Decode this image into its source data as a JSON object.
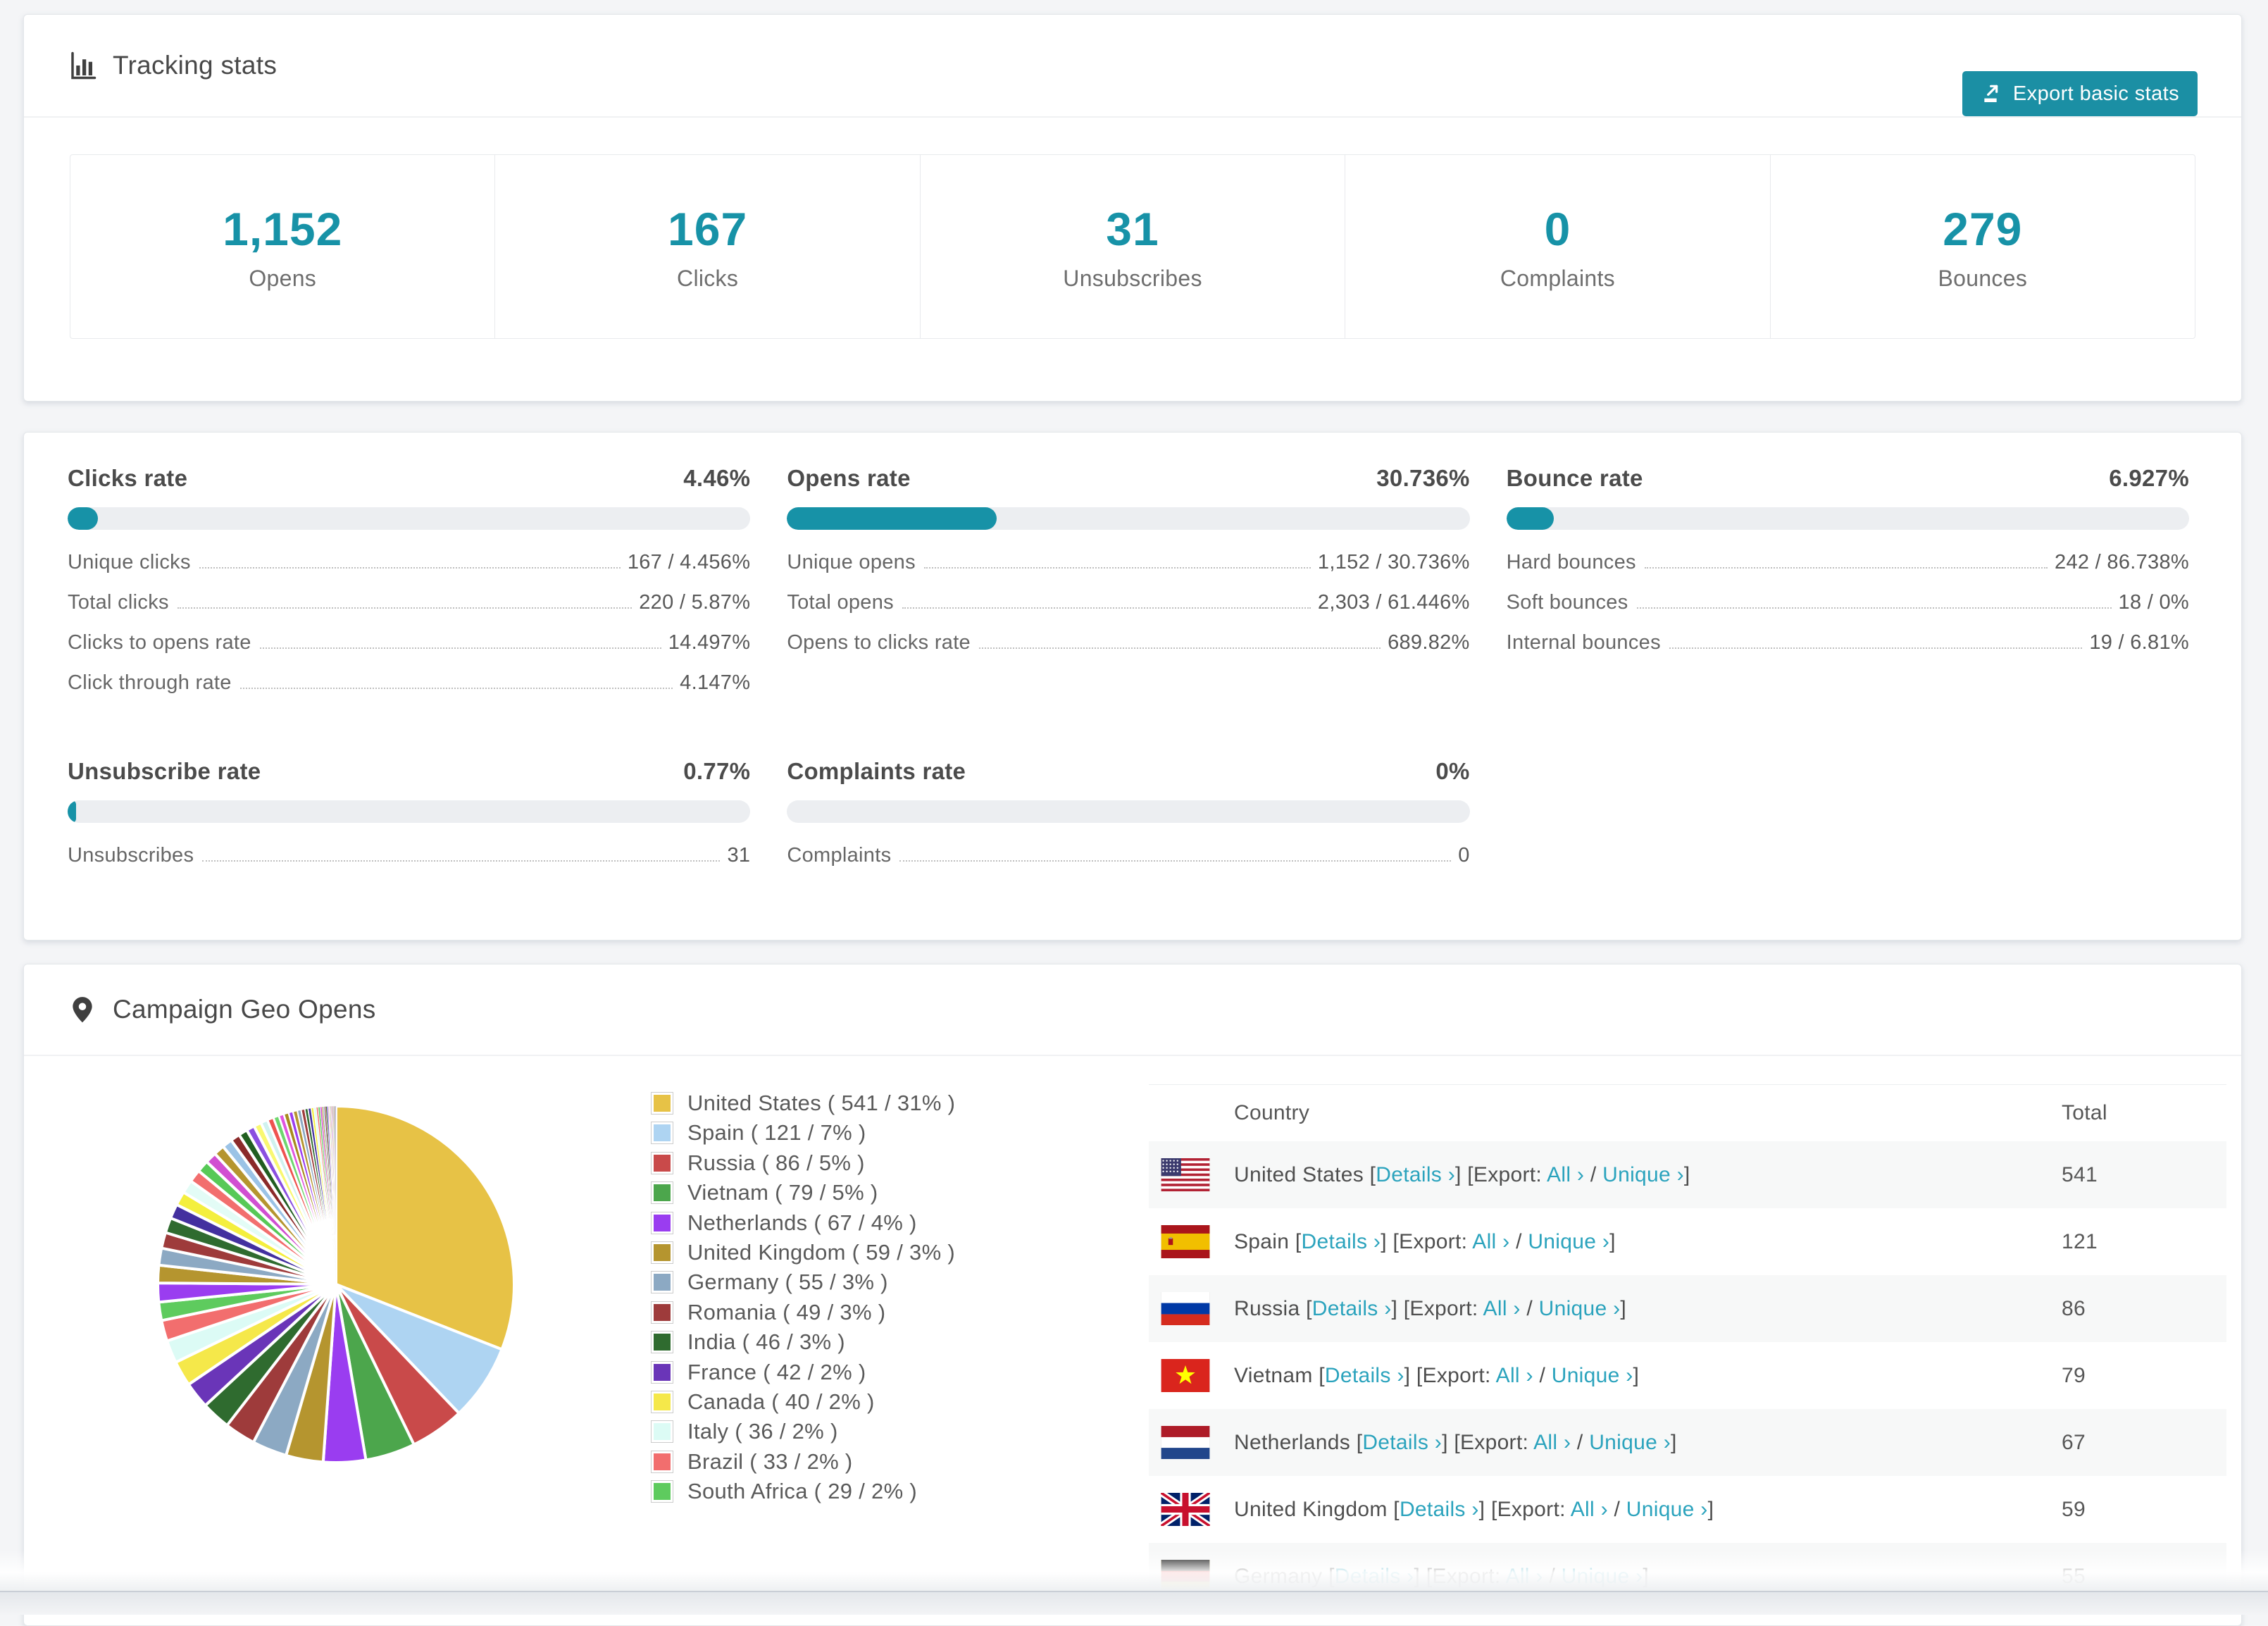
{
  "accent": "#1792a7",
  "link_color": "#2ba3bd",
  "tracking": {
    "title": "Tracking stats",
    "export_button": "Export basic stats",
    "stats": [
      {
        "value": "1,152",
        "label": "Opens"
      },
      {
        "value": "167",
        "label": "Clicks"
      },
      {
        "value": "31",
        "label": "Unsubscribes"
      },
      {
        "value": "0",
        "label": "Complaints"
      },
      {
        "value": "279",
        "label": "Bounces"
      }
    ]
  },
  "rates": {
    "sections": [
      {
        "title": "Clicks rate",
        "value": "4.46%",
        "pct": 4.46,
        "rows": [
          [
            "Unique clicks",
            "167 / 4.456%"
          ],
          [
            "Total clicks",
            "220 / 5.87%"
          ],
          [
            "Clicks to opens rate",
            "14.497%"
          ],
          [
            "Click through rate",
            "4.147%"
          ]
        ]
      },
      {
        "title": "Opens rate",
        "value": "30.736%",
        "pct": 30.736,
        "rows": [
          [
            "Unique opens",
            "1,152 / 30.736%"
          ],
          [
            "Total opens",
            "2,303 / 61.446%"
          ],
          [
            "Opens to clicks rate",
            "689.82%"
          ]
        ]
      },
      {
        "title": "Bounce rate",
        "value": "6.927%",
        "pct": 6.927,
        "rows": [
          [
            "Hard bounces",
            "242 / 86.738%"
          ],
          [
            "Soft bounces",
            "18 / 0%"
          ],
          [
            "Internal bounces",
            "19 / 6.81%"
          ]
        ]
      },
      {
        "title": "Unsubscribe rate",
        "value": "0.77%",
        "pct": 0.77,
        "rows": [
          [
            "Unsubscribes",
            "31"
          ]
        ]
      },
      {
        "title": "Complaints rate",
        "value": "0%",
        "pct": 0,
        "rows": [
          [
            "Complaints",
            "0"
          ]
        ]
      }
    ]
  },
  "geo": {
    "title": "Campaign Geo Opens",
    "legend": [
      {
        "name": "United States",
        "value": 541,
        "pct": 31,
        "color": "#e7c246"
      },
      {
        "name": "Spain",
        "value": 121,
        "pct": 7,
        "color": "#aed4f2"
      },
      {
        "name": "Russia",
        "value": 86,
        "pct": 5,
        "color": "#c94a4a"
      },
      {
        "name": "Vietnam",
        "value": 79,
        "pct": 5,
        "color": "#4ca64c"
      },
      {
        "name": "Netherlands",
        "value": 67,
        "pct": 4,
        "color": "#9a3df0"
      },
      {
        "name": "United Kingdom",
        "value": 59,
        "pct": 3,
        "color": "#b5952f"
      },
      {
        "name": "Germany",
        "value": 55,
        "pct": 3,
        "color": "#8ca9c3"
      },
      {
        "name": "Romania",
        "value": 49,
        "pct": 3,
        "color": "#9e3b3b"
      },
      {
        "name": "India",
        "value": 46,
        "pct": 3,
        "color": "#2f6b2f"
      },
      {
        "name": "France",
        "value": 42,
        "pct": 2,
        "color": "#6a35b8"
      },
      {
        "name": "Canada",
        "value": 40,
        "pct": 2,
        "color": "#f5e84a"
      },
      {
        "name": "Italy",
        "value": 36,
        "pct": 2,
        "color": "#dcfbf5"
      },
      {
        "name": "Brazil",
        "value": 33,
        "pct": 2,
        "color": "#f26e6e"
      },
      {
        "name": "South Africa",
        "value": 29,
        "pct": 2,
        "color": "#5ecb5e"
      }
    ],
    "table": {
      "headers": [
        "Country",
        "Total"
      ],
      "tok": {
        "t1": " [",
        "t2": "] [Export: ",
        "t3": " / ",
        "t4": "]",
        "details": "Details ›",
        "all": "All ›",
        "unique": "Unique ›"
      },
      "rows": [
        {
          "country": "United States",
          "flag": "us",
          "total": "541"
        },
        {
          "country": "Spain",
          "flag": "es",
          "total": "121"
        },
        {
          "country": "Russia",
          "flag": "ru",
          "total": "86"
        },
        {
          "country": "Vietnam",
          "flag": "vn",
          "total": "79"
        },
        {
          "country": "Netherlands",
          "flag": "nl",
          "total": "67"
        },
        {
          "country": "United Kingdom",
          "flag": "gb",
          "total": "59"
        },
        {
          "country": "Germany",
          "flag": "de",
          "total": "55"
        }
      ]
    }
  },
  "chart_data": {
    "type": "pie",
    "title": "Campaign Geo Opens",
    "unit": "opens",
    "legend_position": "right",
    "labeled_slices": [
      {
        "label": "United States",
        "value": 541,
        "pct": 31
      },
      {
        "label": "Spain",
        "value": 121,
        "pct": 7
      },
      {
        "label": "Russia",
        "value": 86,
        "pct": 5
      },
      {
        "label": "Vietnam",
        "value": 79,
        "pct": 5
      },
      {
        "label": "Netherlands",
        "value": 67,
        "pct": 4
      },
      {
        "label": "United Kingdom",
        "value": 59,
        "pct": 3
      },
      {
        "label": "Germany",
        "value": 55,
        "pct": 3
      },
      {
        "label": "Romania",
        "value": 49,
        "pct": 3
      },
      {
        "label": "India",
        "value": 46,
        "pct": 3
      },
      {
        "label": "France",
        "value": 42,
        "pct": 2
      },
      {
        "label": "Canada",
        "value": 40,
        "pct": 2
      },
      {
        "label": "Italy",
        "value": 36,
        "pct": 2
      },
      {
        "label": "Brazil",
        "value": 33,
        "pct": 2
      },
      {
        "label": "South Africa",
        "value": 29,
        "pct": 2
      }
    ],
    "unlabeled_other_values": [
      30,
      28,
      27,
      25,
      24,
      23,
      22,
      21,
      20,
      19,
      18,
      17,
      16,
      15,
      14,
      13,
      12,
      11,
      10,
      9,
      8,
      8,
      7,
      7,
      6,
      6,
      5,
      5,
      4,
      4,
      3,
      3,
      3,
      2,
      2,
      2,
      2,
      2,
      1,
      1,
      1,
      1,
      1,
      1,
      1,
      1,
      1,
      1,
      1,
      1
    ],
    "palette_named": [
      "#e7c246",
      "#aed4f2",
      "#c94a4a",
      "#4ca64c",
      "#9a3df0",
      "#b5952f",
      "#8ca9c3",
      "#9e3b3b",
      "#2f6b2f",
      "#6a35b8",
      "#f5e84a",
      "#dcfbf5",
      "#f26e6e",
      "#5ecb5e"
    ],
    "palette_other": [
      "#9a3df0",
      "#b5952f",
      "#8ca9c3",
      "#9e3b3b",
      "#2f6b2f",
      "#43309f",
      "#f4ef3e",
      "#e3fcf6",
      "#f26e6e",
      "#57c957",
      "#d14fd1",
      "#b5952f",
      "#9bc3e6",
      "#8b2a2a",
      "#215e21",
      "#8a4fe0",
      "#f9f871",
      "#d0f2ef",
      "#ef5350",
      "#6fd66f",
      "#e055e0",
      "#a88a1e"
    ]
  }
}
